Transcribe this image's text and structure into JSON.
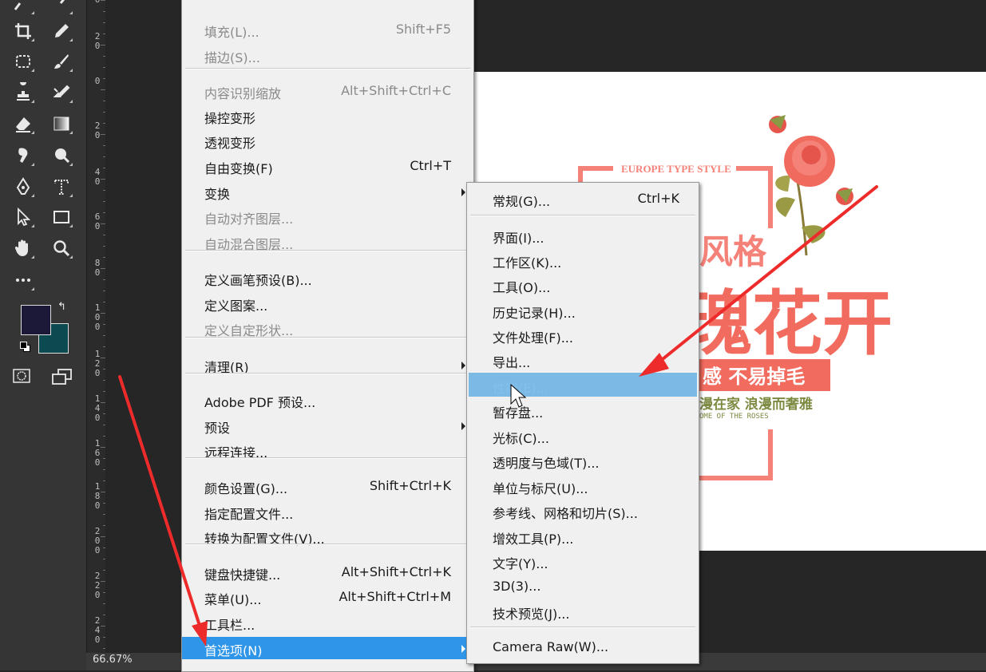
{
  "status": {
    "zoom": "66.67%"
  },
  "ruler": {
    "labels": [
      "0",
      "2\n0",
      "0",
      "2\n0",
      "4\n0",
      "6\n0",
      "8\n0",
      "1\n0\n0",
      "1\n2\n0",
      "1\n4\n0",
      "1\n6\n0",
      "1\n8\n0",
      "2\n0\n0",
      "2\n2\n0",
      "2\n4\n0"
    ]
  },
  "colors": {
    "foreground": "#1b1838",
    "background": "#0c4a51",
    "menu_highlight": "#2e95e8",
    "arrow": "#ee2b2b",
    "canvas_pink": "#f58278",
    "canvas_green": "#7c8a42"
  },
  "tools": [
    "move-icon",
    "brush-icon",
    "crop-icon",
    "eyedropper-icon",
    "marquee-icon",
    "brush-tool-icon",
    "stamp-icon",
    "history-brush-icon",
    "eraser-icon",
    "gradient-icon",
    "smudge-icon",
    "dodge-icon",
    "pen-icon",
    "text-tool-icon",
    "path-select-icon",
    "rectangle-icon",
    "hand-icon",
    "zoom-icon",
    "more-icon"
  ],
  "edit_menu": {
    "items": [
      {
        "label": "填充(L)...",
        "shortcut": "Shift+F5",
        "disabled": true
      },
      {
        "label": "描边(S)...",
        "shortcut": "",
        "disabled": true
      },
      {
        "label": "内容识别缩放",
        "shortcut": "Alt+Shift+Ctrl+C",
        "disabled": true
      },
      {
        "label": "操控变形",
        "shortcut": "",
        "disabled": false
      },
      {
        "label": "透视变形",
        "shortcut": "",
        "disabled": false
      },
      {
        "label": "自由变换(F)",
        "shortcut": "Ctrl+T",
        "disabled": false
      },
      {
        "label": "变换",
        "shortcut": "",
        "disabled": false
      },
      {
        "label": "自动对齐图层...",
        "shortcut": "",
        "disabled": true
      },
      {
        "label": "自动混合图层...",
        "shortcut": "",
        "disabled": true
      },
      {
        "label": "定义画笔预设(B)...",
        "shortcut": "",
        "disabled": false
      },
      {
        "label": "定义图案...",
        "shortcut": "",
        "disabled": false
      },
      {
        "label": "定义自定形状...",
        "shortcut": "",
        "disabled": true
      },
      {
        "label": "清理(R)",
        "shortcut": "",
        "disabled": false
      },
      {
        "label": "Adobe PDF 预设...",
        "shortcut": "",
        "disabled": false
      },
      {
        "label": "预设",
        "shortcut": "",
        "disabled": false
      },
      {
        "label": "远程连接...",
        "shortcut": "",
        "disabled": false
      },
      {
        "label": "颜色设置(G)...",
        "shortcut": "Shift+Ctrl+K",
        "disabled": false
      },
      {
        "label": "指定配置文件...",
        "shortcut": "",
        "disabled": false
      },
      {
        "label": "转换为配置文件(V)...",
        "shortcut": "",
        "disabled": false
      },
      {
        "label": "键盘快捷键...",
        "shortcut": "Alt+Shift+Ctrl+K",
        "disabled": false
      },
      {
        "label": "菜单(U)...",
        "shortcut": "Alt+Shift+Ctrl+M",
        "disabled": false
      },
      {
        "label": "工具栏...",
        "shortcut": "",
        "disabled": false
      },
      {
        "label": "首选项(N)",
        "shortcut": "",
        "disabled": false
      }
    ]
  },
  "preferences_menu": {
    "items": [
      {
        "label": "常规(G)...",
        "shortcut": "Ctrl+K"
      },
      {
        "label": "界面(I)...",
        "shortcut": ""
      },
      {
        "label": "工作区(K)...",
        "shortcut": ""
      },
      {
        "label": "工具(O)...",
        "shortcut": ""
      },
      {
        "label": "历史记录(H)...",
        "shortcut": ""
      },
      {
        "label": "文件处理(F)...",
        "shortcut": ""
      },
      {
        "label": "导出...",
        "shortcut": ""
      },
      {
        "label": "性能(E)...",
        "shortcut": ""
      },
      {
        "label": "暂存盘...",
        "shortcut": ""
      },
      {
        "label": "光标(C)...",
        "shortcut": ""
      },
      {
        "label": "透明度与色域(T)...",
        "shortcut": ""
      },
      {
        "label": "单位与标尺(U)...",
        "shortcut": ""
      },
      {
        "label": "参考线、网格和切片(S)...",
        "shortcut": ""
      },
      {
        "label": "增效工具(P)...",
        "shortcut": ""
      },
      {
        "label": "文字(Y)...",
        "shortcut": ""
      },
      {
        "label": "3D(3)...",
        "shortcut": ""
      },
      {
        "label": "技术预览(J)...",
        "shortcut": ""
      },
      {
        "label": "Camera Raw(W)...",
        "shortcut": ""
      }
    ]
  },
  "canvas": {
    "top_text": "EUROPE TYPE STYLE",
    "line1": "风格",
    "line2": "瑰花开",
    "banner": "感  不易掉毛",
    "line3": "漫在家   浪漫而奢雅",
    "line4": "OME OF THE ROSES"
  }
}
